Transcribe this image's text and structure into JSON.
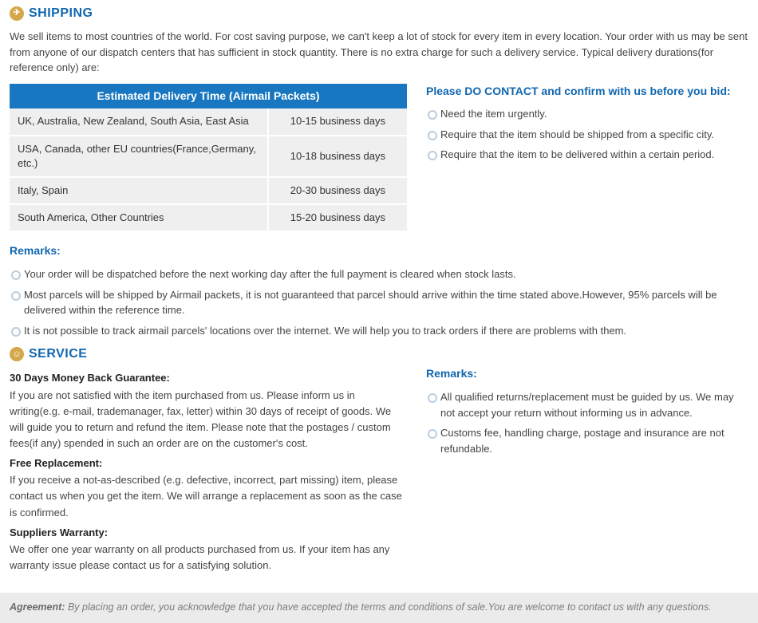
{
  "shipping": {
    "title": "SHIPPING",
    "intro": "We sell items to most countries of the world. For cost saving purpose, we can't keep a lot of stock for every item in every location. Your order with us may be sent from anyone of our dispatch centers that has sufficient in stock quantity. There is no extra charge for such a delivery service. Typical delivery durations(for reference only) are:",
    "table_title": "Estimated Delivery Time (Airmail Packets)",
    "rows": [
      {
        "region": "UK, Australia, New Zealand, South Asia, East Asia",
        "time": "10-15 business days"
      },
      {
        "region": "USA, Canada, other EU countries(France,Germany, etc.)",
        "time": "10-18 business days"
      },
      {
        "region": "Italy, Spain",
        "time": "20-30 business days"
      },
      {
        "region": "South America, Other Countries",
        "time": "15-20 business days"
      }
    ],
    "contact_heading": "Please DO CONTACT and confirm with us before you bid:",
    "contact_points": [
      "Need the item urgently.",
      "Require that the item should be shipped from a specific city.",
      "Require that the item to be delivered within a certain period."
    ],
    "remarks_heading": "Remarks:",
    "remarks": [
      "Your order will be dispatched before the next working day after the full payment is cleared when stock lasts.",
      "Most parcels will be shipped by Airmail packets, it is not guaranteed that parcel should arrive within the time stated above.However, 95% parcels will be delivered within the reference time.",
      "It is not possible to track airmail parcels' locations over the internet. We will help you to track orders if there are problems with them."
    ]
  },
  "service": {
    "title": "SERVICE",
    "guarantee_heading": "30 Days Money Back Guarantee:",
    "guarantee_text": "If you are not satisfied with the item purchased from us. Please inform us in writing(e.g. e-mail, trademanager, fax, letter) within 30 days of receipt of goods. We will guide you to return and refund the item. Please note that the postages / custom fees(if any) spended in such an order are on the customer's cost.",
    "replacement_heading": "Free Replacement:",
    "replacement_text": "If you receive a not-as-described (e.g. defective, incorrect, part missing) item, please contact us when you get the item. We will arrange a replacement as soon as the case is confirmed.",
    "warranty_heading": "Suppliers Warranty:",
    "warranty_text": "We offer one year warranty on all products purchased from us. If your item has any warranty issue please contact us for a satisfying solution.",
    "remarks_heading": "Remarks:",
    "remarks": [
      "All qualified returns/replacement must be guided by us. We may not accept your return without informing us in advance.",
      "Customs fee, handling charge, postage and insurance are not refundable."
    ]
  },
  "agreement": {
    "label": "Agreement:",
    "text": " By placing an order, you acknowledge that you have accepted the terms and conditions of sale.You are welcome to contact us with any questions."
  }
}
